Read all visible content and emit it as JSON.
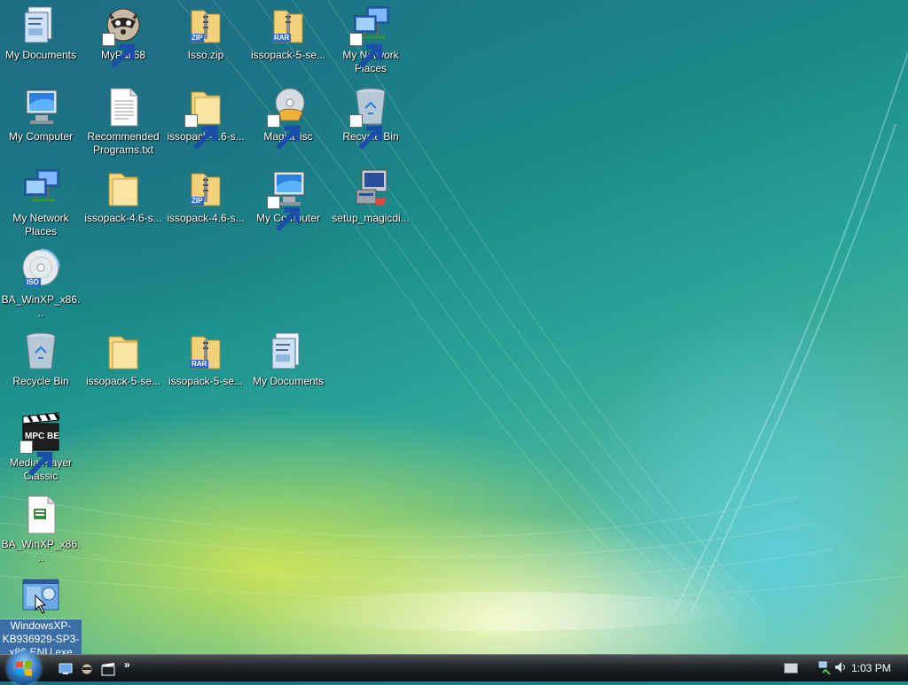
{
  "desktop": {
    "icons": [
      {
        "label": "My Documents",
        "icon": "documents-folder-icon",
        "shortcut": false
      },
      {
        "label": "MyPal 68",
        "icon": "raccoon-app-icon",
        "shortcut": true
      },
      {
        "label": "Isso.zip",
        "icon": "zip-archive-icon",
        "badge": "ZIP",
        "shortcut": false
      },
      {
        "label": "issopack-5-se...",
        "icon": "rar-archive-icon",
        "badge": "RAR",
        "shortcut": false
      },
      {
        "label": "My Network Places",
        "icon": "network-places-icon",
        "shortcut": true
      },
      {
        "label": "My Computer",
        "icon": "computer-icon",
        "shortcut": false
      },
      {
        "label": "Recommended Programs.txt",
        "icon": "text-file-icon",
        "shortcut": false
      },
      {
        "label": "issopack-4.6-s...",
        "icon": "folder-icon",
        "shortcut": true
      },
      {
        "label": "MagicDisc",
        "icon": "magicdisc-icon",
        "shortcut": true
      },
      {
        "label": "Recycle Bin",
        "icon": "recycle-bin-icon",
        "shortcut": true
      },
      {
        "label": "My Network Places",
        "icon": "network-places-icon",
        "shortcut": false
      },
      {
        "label": "issopack-4.6-s...",
        "icon": "folder-icon",
        "shortcut": false
      },
      {
        "label": "issopack-4.6-s...",
        "icon": "zip-archive-icon",
        "badge": "ZIP",
        "shortcut": false
      },
      {
        "label": "My Computer",
        "icon": "computer-icon",
        "shortcut": true
      },
      {
        "label": "setup_magicdi...",
        "icon": "setup-installer-icon",
        "shortcut": false
      },
      {
        "label": "BA_WinXP_x86...",
        "icon": "iso-disc-icon",
        "badge": "ISO",
        "shortcut": false
      },
      {
        "label": "Recycle Bin",
        "icon": "recycle-bin-icon",
        "shortcut": false
      },
      {
        "label": "issopack-5-se...",
        "icon": "folder-icon",
        "shortcut": false
      },
      {
        "label": "issopack-5-se...",
        "icon": "rar-archive-icon",
        "badge": "RAR",
        "shortcut": false
      },
      {
        "label": "My Documents",
        "icon": "documents-folder-icon",
        "shortcut": false
      },
      {
        "label": "Media Player Classic",
        "icon": "mpc-be-clapper-icon",
        "badge": "MPC BE",
        "shortcut": true
      },
      {
        "label": "BA_WinXP_x86...",
        "icon": "document-file-icon",
        "shortcut": false
      },
      {
        "label": "WindowsXP-KB936929-SP3-x86-ENU.exe",
        "icon": "installer-exe-icon",
        "shortcut": false,
        "selected": true
      }
    ]
  },
  "taskbar": {
    "start_button": "windows-orb-icon",
    "quick_launch": [
      "show-desktop-icon",
      "mypal-icon",
      "mpc-be-icon"
    ],
    "quick_launch_more": "»",
    "tray": [
      "keyboard-icon",
      "network-icon",
      "volume-icon"
    ],
    "clock": "1:03 PM"
  },
  "colors": {
    "selection": "#3a6ea5",
    "taskbar": "#1d2124",
    "wallpaper_teal": "#1b8a8a",
    "wallpaper_yellow": "#e2ec4c"
  }
}
